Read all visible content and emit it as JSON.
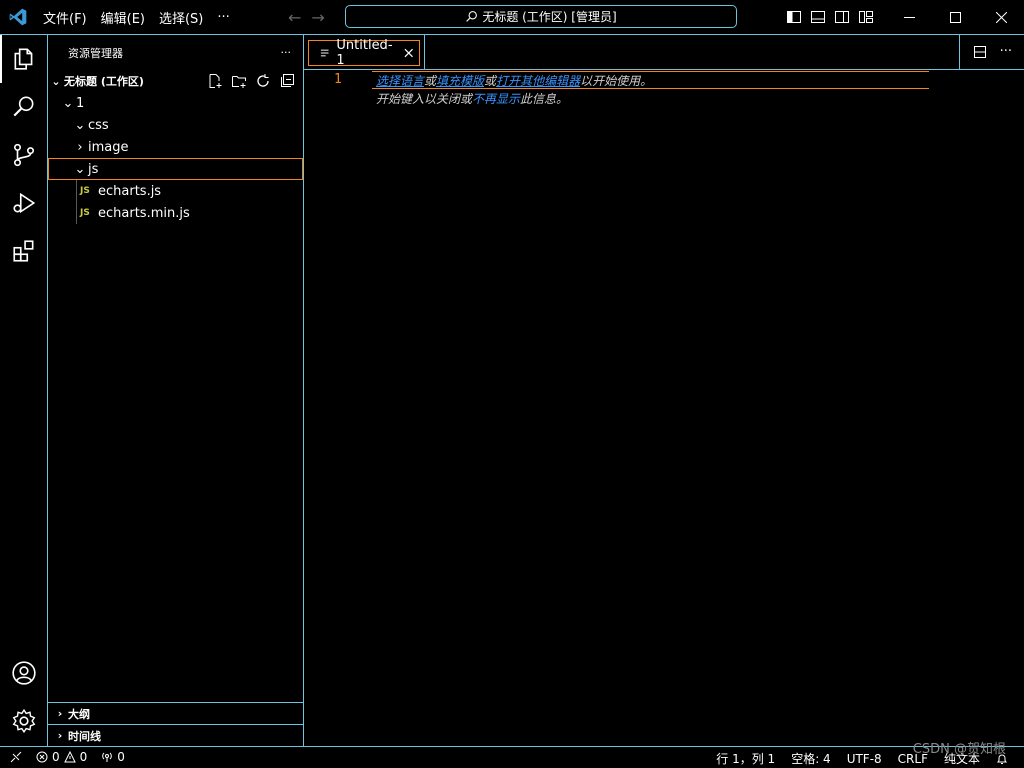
{
  "titlebar": {
    "menu": [
      "文件(F)",
      "编辑(E)",
      "选择(S)",
      "···"
    ],
    "search_text": "无标题 (工作区) [管理员]"
  },
  "sidebar": {
    "title": "资源管理器",
    "more": "···",
    "workspace": "无标题 (工作区)",
    "tree": [
      {
        "label": "1",
        "type": "folder",
        "expanded": true
      },
      {
        "label": "css",
        "type": "folder",
        "expanded": true
      },
      {
        "label": "image",
        "type": "folder",
        "expanded": false
      },
      {
        "label": "js",
        "type": "folder",
        "expanded": true,
        "selected": true
      },
      {
        "label": "echarts.js",
        "type": "file",
        "badge": "JS"
      },
      {
        "label": "echarts.min.js",
        "type": "file",
        "badge": "JS"
      }
    ],
    "outline": "大纲",
    "timeline": "时间线"
  },
  "editor": {
    "tab_label": "Untitled-1",
    "line_number": "1",
    "hint1": {
      "select_lang": "选择语言",
      "or1": "或",
      "fill_template": "填充模版",
      "or2": "或",
      "open_other": "打开其他编辑器",
      "suffix": "以开始使用。"
    },
    "hint2": {
      "prefix": "开始键入以关闭或",
      "dont_show": "不再显示",
      "suffix": "此信息。"
    }
  },
  "statusbar": {
    "errors": "0",
    "warnings": "0",
    "ports": "0",
    "position": "行 1，列 1",
    "spaces": "空格: 4",
    "encoding": "UTF-8",
    "eol": "CRLF",
    "language": "纯文本"
  },
  "watermark": "CSDN @贺知根",
  "colors": {
    "border": "#6fc3df",
    "focus": "#f38518",
    "link": "#3794ff",
    "js": "#cbcb41"
  }
}
